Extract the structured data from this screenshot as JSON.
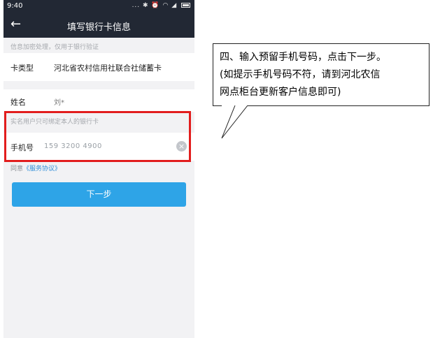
{
  "status_bar": {
    "time": "9:40",
    "icons_text": "...  ✱ ⏰ ◠ ◢"
  },
  "nav": {
    "back_icon": "arrow-left-icon",
    "title": "填写银行卡信息"
  },
  "hint_encrypt": "信息加密处理，仅用于银行验证",
  "card": {
    "label": "卡类型",
    "value": "河北省农村信用社联合社储蓄卡"
  },
  "name": {
    "label": "姓名",
    "value": "刘*"
  },
  "hint_realname": "实名用户只可绑定本人的银行卡",
  "phone": {
    "label": "手机号",
    "value": "159 3200 4900",
    "clear_icon": "clear-circle-icon"
  },
  "agreement": {
    "prefix": "同意",
    "link": "《服务协议》"
  },
  "next_button": "下一步",
  "callout": {
    "line1": "四、输入预留手机号码，点击下一步。",
    "line2": "(如提示手机号码不符，请到河北农信",
    "line3": "网点柜台更新客户信息即可)"
  },
  "colors": {
    "navbar": "#222834",
    "primary_button": "#2ea4e7",
    "link": "#2f8ed8",
    "highlight_border": "#e21d1d"
  }
}
